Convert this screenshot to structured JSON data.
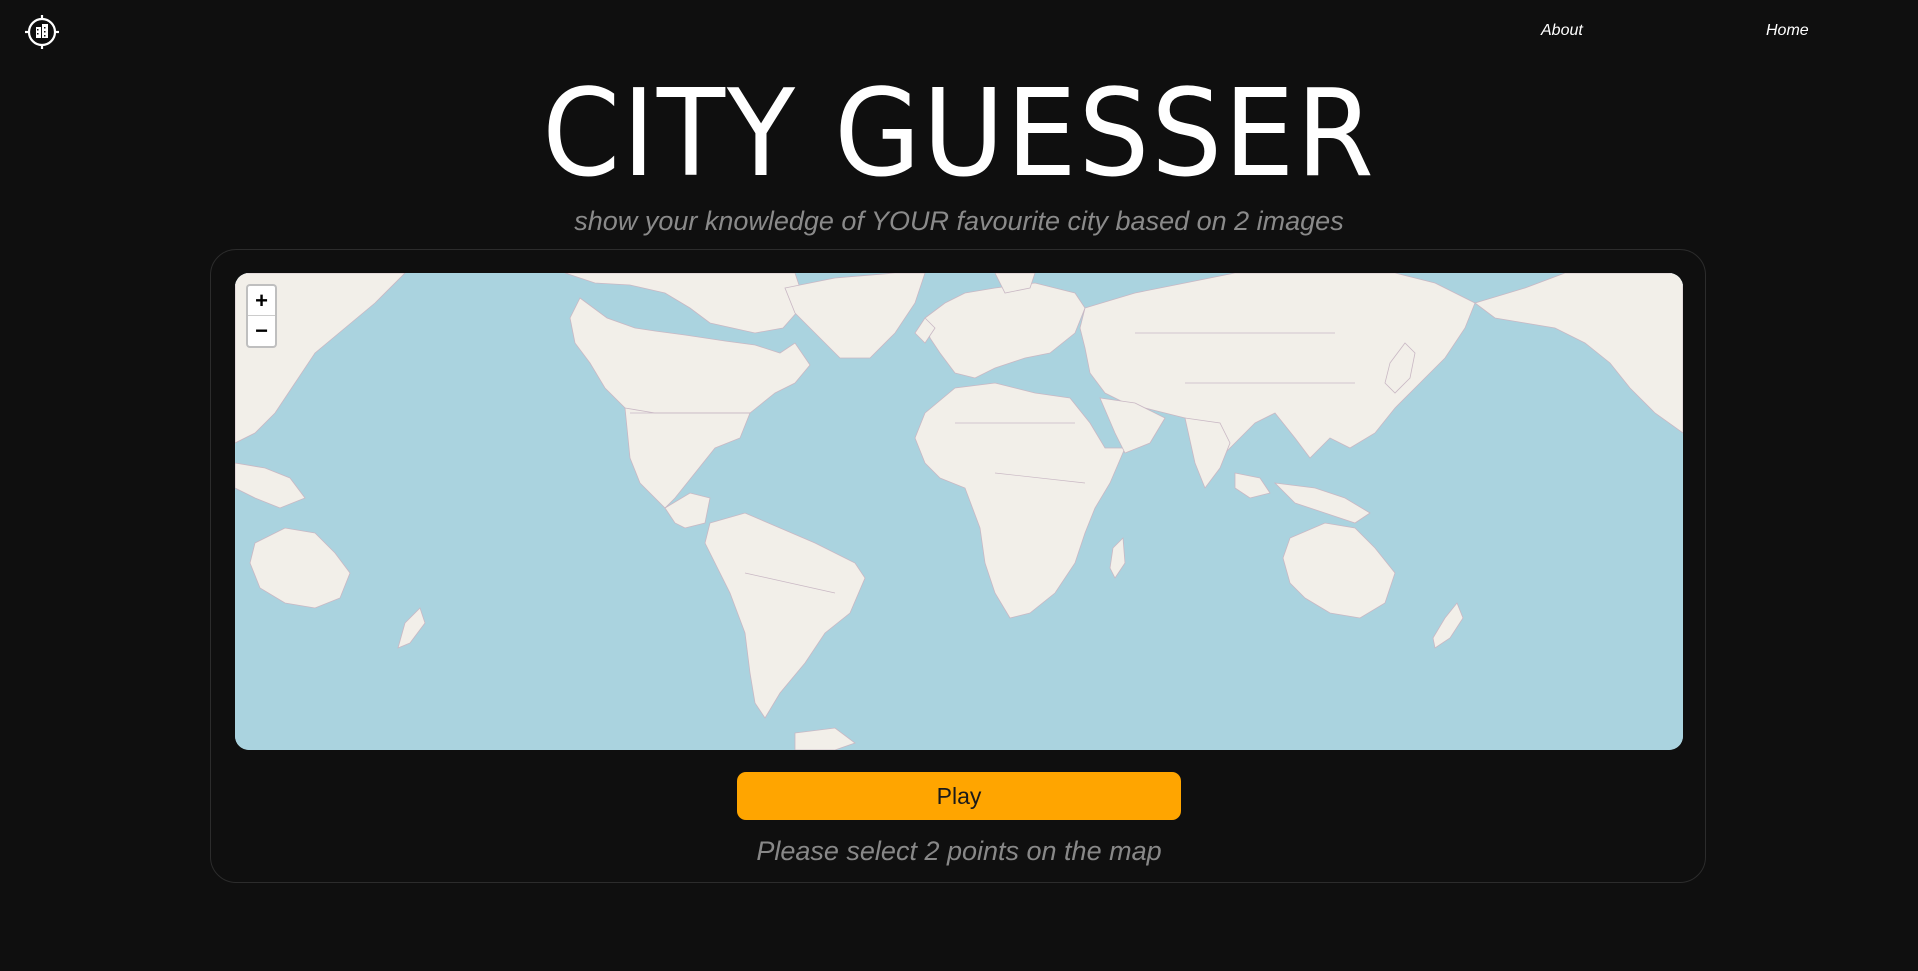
{
  "header": {
    "logo_icon": "city-target-icon",
    "nav": {
      "about_label": "About",
      "home_label": "Home"
    }
  },
  "hero": {
    "title": "CITY GUESSER",
    "subtitle": "show your knowledge of YOUR favourite city based on 2 images"
  },
  "map": {
    "zoom_in_label": "+",
    "zoom_out_label": "−",
    "ocean_color": "#aad3df",
    "land_color": "#f2efe9"
  },
  "actions": {
    "play_label": "Play",
    "play_color": "#ffa500"
  },
  "status": {
    "hint": "Please select 2 points on the map"
  }
}
